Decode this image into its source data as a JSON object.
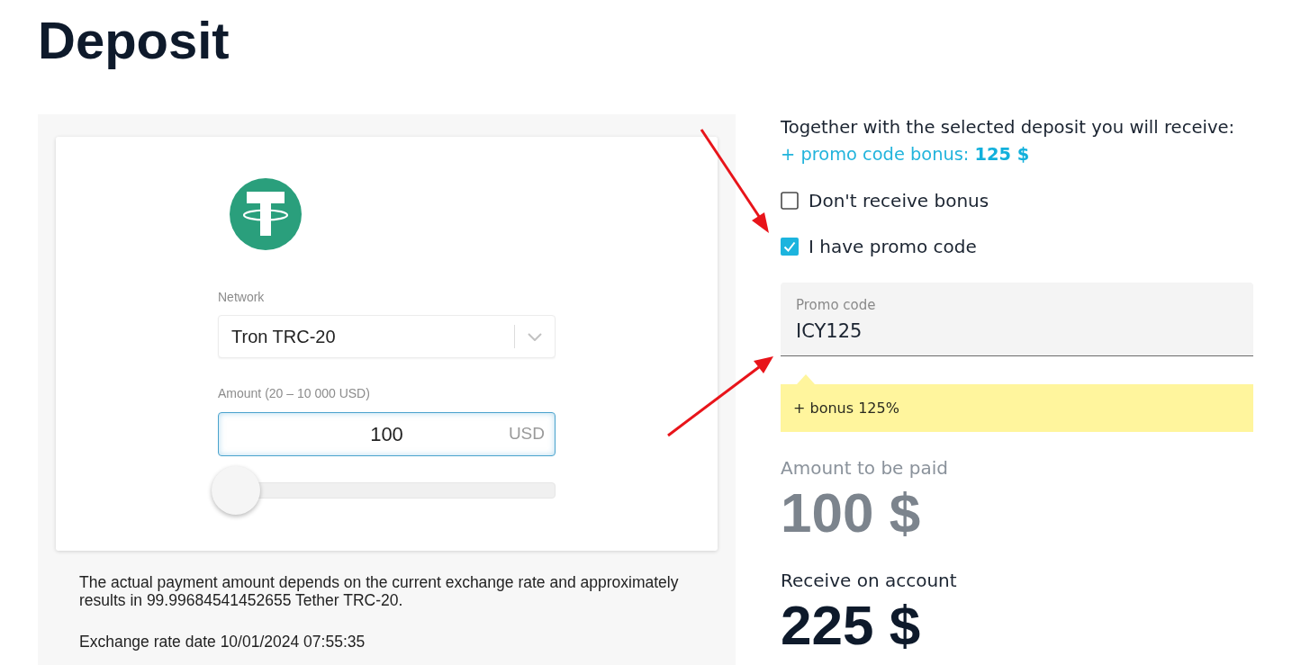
{
  "page_title": "Deposit",
  "payment_card": {
    "network": {
      "label": "Network",
      "value": "Tron TRC-20"
    },
    "amount": {
      "label": "Amount (20 – 10 000 USD)",
      "value": "100",
      "currency": "USD",
      "level": 0
    }
  },
  "notes": [
    "The actual payment amount depends on the current exchange rate and approximately results in 99.99684541452655 Tether TRC-20.",
    "Exchange rate date 10/01/2024 07:55:35"
  ],
  "bonus_summary": {
    "intro": "Together with the selected deposit you will receive:",
    "bonus_line": "+ promo code bonus: **125 $**"
  },
  "options": [
    {
      "label": "Don't receive bonus",
      "checked": false
    },
    {
      "label": "I have promo code",
      "checked": true
    }
  ],
  "promo_field": {
    "label": "Promo code",
    "value": "ICY125"
  },
  "promo_hint": "+ bonus 125%",
  "totals": [
    {
      "kind": "muted",
      "label": "Amount to be paid",
      "value": "100 $"
    },
    {
      "kind": "primary",
      "label": "Receive on account",
      "value": "225 $"
    }
  ]
}
